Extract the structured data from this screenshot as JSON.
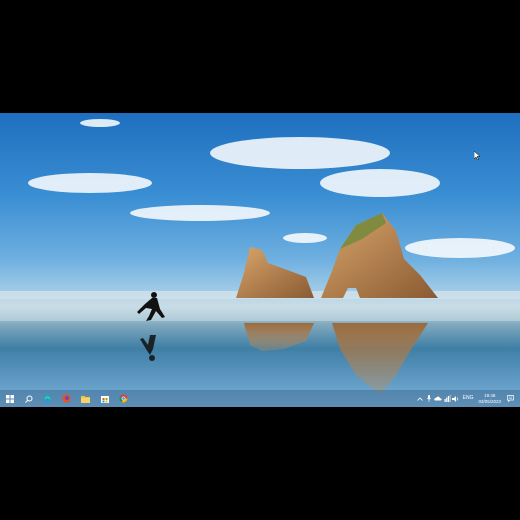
{
  "taskbar": {
    "pinned": [
      {
        "name": "start",
        "icon": "windows-logo-icon"
      },
      {
        "name": "search",
        "icon": "search-icon"
      },
      {
        "name": "edge",
        "icon": "edge-icon"
      },
      {
        "name": "firefox",
        "icon": "firefox-icon"
      },
      {
        "name": "file-explorer",
        "icon": "folder-icon"
      },
      {
        "name": "store",
        "icon": "store-icon"
      },
      {
        "name": "chrome",
        "icon": "chrome-icon"
      }
    ],
    "tray": {
      "language": "ENG",
      "time": "19:48",
      "date": "03/05/2023"
    }
  },
  "colors": {
    "taskbar_tint": "#28507a",
    "sky_top": "#1e6fbe",
    "sea": "#3f7fa6"
  }
}
